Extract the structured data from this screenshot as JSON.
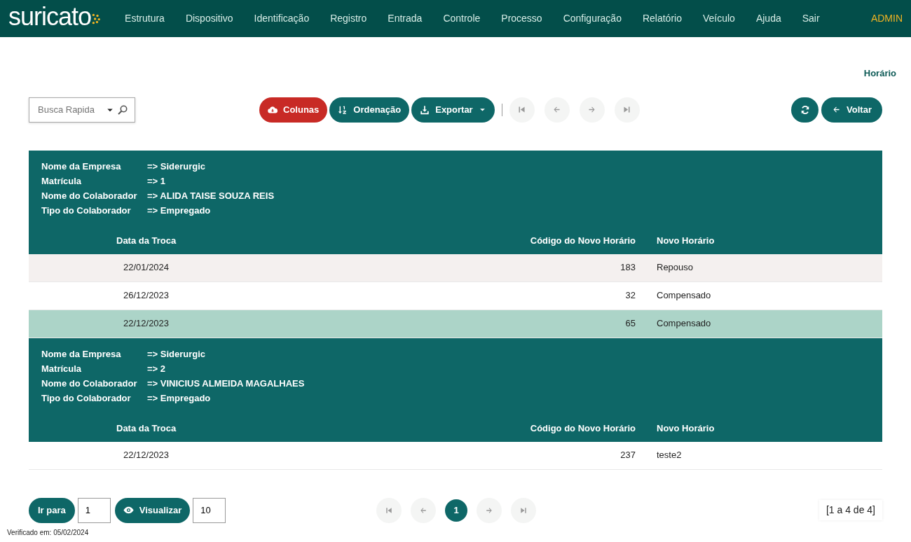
{
  "logo": {
    "text": "suricato"
  },
  "nav": {
    "items": [
      {
        "label": "Estrutura"
      },
      {
        "label": "Dispositivo"
      },
      {
        "label": "Identificação"
      },
      {
        "label": "Registro"
      },
      {
        "label": "Entrada"
      },
      {
        "label": "Controle"
      },
      {
        "label": "Processo"
      },
      {
        "label": "Configuração"
      },
      {
        "label": "Relatório"
      },
      {
        "label": "Veículo"
      },
      {
        "label": "Ajuda"
      },
      {
        "label": "Sair"
      }
    ],
    "user": "ADMIN"
  },
  "page_title": "Horário",
  "toolbar": {
    "search": {
      "placeholder": "Busca Rapida"
    },
    "buttons": [
      {
        "kind": "columns",
        "label": "Colunas",
        "dropdown": false
      },
      {
        "kind": "sort",
        "label": "Ordenação",
        "dropdown": false
      },
      {
        "kind": "export",
        "label": "Exportar",
        "dropdown": true
      }
    ],
    "pager": [
      {
        "kind": "first",
        "disabled": true
      },
      {
        "kind": "prev",
        "disabled": true
      },
      {
        "kind": "next",
        "disabled": true
      },
      {
        "kind": "last",
        "disabled": true
      }
    ],
    "back_button": {
      "label": "Voltar"
    }
  },
  "groups": [
    {
      "fields": [
        {
          "label": "Nome da Empresa",
          "value": "=> Siderurgic"
        },
        {
          "label": "Matrícula",
          "value": "=> 1"
        },
        {
          "label": "Nome do Colaborador",
          "value": "=> ALIDA TAISE SOUZA REIS"
        },
        {
          "label": "Tipo do Colaborador",
          "value": "=> Empregado"
        }
      ],
      "columns": [
        "Data da Troca",
        "Código do Novo Horário",
        "Novo Horário"
      ],
      "rows": [
        {
          "cells": [
            "22/01/2024",
            "183",
            "Repouso"
          ],
          "hovered": true,
          "selected": false
        },
        {
          "cells": [
            "26/12/2023",
            "32",
            "Compensado"
          ],
          "hovered": false,
          "selected": false
        },
        {
          "cells": [
            "22/12/2023",
            "65",
            "Compensado"
          ],
          "hovered": false,
          "selected": true
        }
      ]
    },
    {
      "fields": [
        {
          "label": "Nome da Empresa",
          "value": "=> Siderurgic"
        },
        {
          "label": "Matrícula",
          "value": "=> 2"
        },
        {
          "label": "Nome do Colaborador",
          "value": "=> VINICIUS ALMEIDA MAGALHAES"
        },
        {
          "label": "Tipo do Colaborador",
          "value": "=> Empregado"
        }
      ],
      "columns": [
        "Data da Troca",
        "Código do Novo Horário",
        "Novo Horário"
      ],
      "rows": [
        {
          "cells": [
            "22/12/2023",
            "237",
            "teste2"
          ],
          "hovered": false,
          "selected": false
        }
      ]
    }
  ],
  "footer": {
    "goto_button": "Ir para",
    "goto_value": "1",
    "view_button": "Visualizar",
    "view_value": "10",
    "pager": [
      {
        "kind": "first",
        "disabled": true
      },
      {
        "kind": "prev",
        "disabled": true
      },
      {
        "kind": "page",
        "label": "1",
        "selected": true
      },
      {
        "kind": "next",
        "disabled": true
      },
      {
        "kind": "last",
        "disabled": true
      }
    ],
    "range": "[1 a 4 de 4]"
  },
  "verified": "Verificado em: 05/02/2024"
}
